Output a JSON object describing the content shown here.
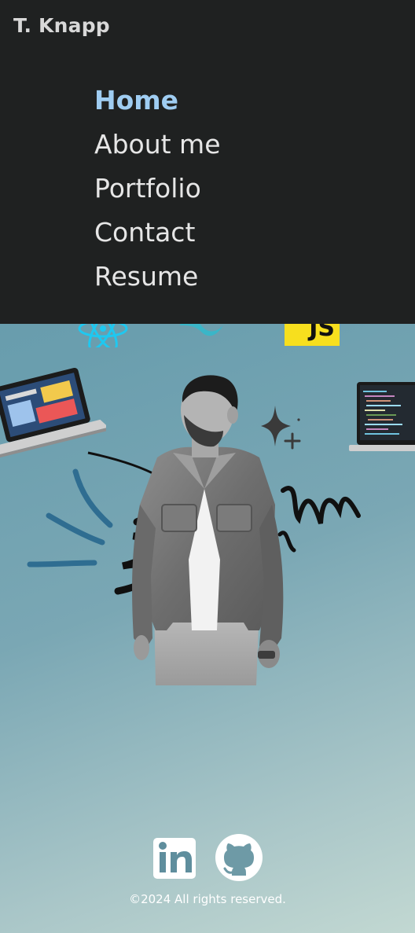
{
  "header": {
    "brand": "T. Knapp"
  },
  "nav": {
    "items": [
      {
        "label": "Home",
        "active": true
      },
      {
        "label": "About me",
        "active": false
      },
      {
        "label": "Portfolio",
        "active": false
      },
      {
        "label": "Contact",
        "active": false
      },
      {
        "label": "Resume",
        "active": false
      }
    ]
  },
  "hero": {
    "tech_icons": [
      "react-icon",
      "tailwind-icon",
      "javascript-icon"
    ],
    "js_badge": "JS"
  },
  "footer": {
    "social": [
      "linkedin-icon",
      "github-icon"
    ],
    "copyright": "©2024 All rights reserved."
  },
  "colors": {
    "nav_bg": "#1f2121",
    "active_link": "#9fcdf2",
    "link": "#e6e6e6",
    "react": "#1fc8f0",
    "js_yellow": "#f7df1e"
  }
}
